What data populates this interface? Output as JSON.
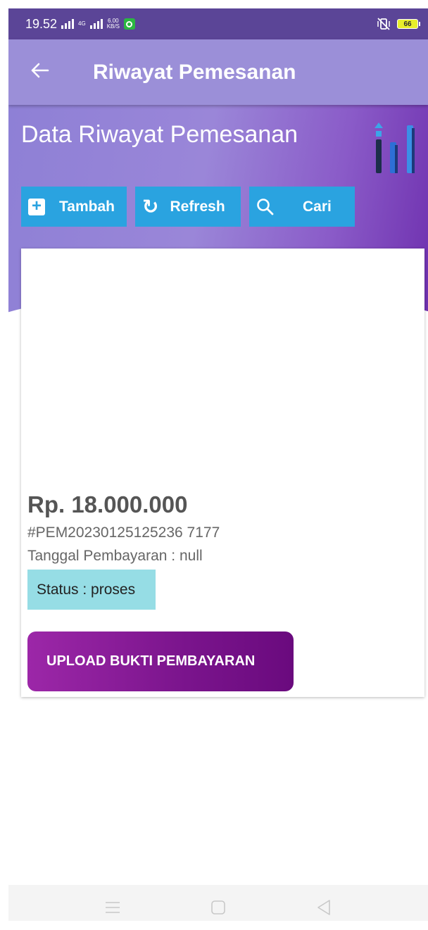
{
  "status_bar": {
    "time": "19.52",
    "network_label": "4G",
    "speed_value": "6.00",
    "speed_unit": "KB/S",
    "battery": "66"
  },
  "app_bar": {
    "title": "Riwayat Pemesanan"
  },
  "hero": {
    "title": "Data Riwayat Pemesanan"
  },
  "actions": {
    "tambah": "Tambah",
    "refresh": "Refresh",
    "cari": "Cari"
  },
  "order": {
    "price": "Rp. 18.000.000",
    "code": "#PEM20230125125236 7177",
    "payment_date": "Tanggal Pembayaran : null",
    "status": "Status : proses",
    "upload_label": "UPLOAD BUKTI PEMBAYARAN"
  },
  "colors": {
    "status_bar": "#5b4597",
    "app_bar": "#9b8fd8",
    "action_button": "#2aa3e0",
    "status_badge": "#96dde5",
    "upload_button": "#7a148c"
  }
}
